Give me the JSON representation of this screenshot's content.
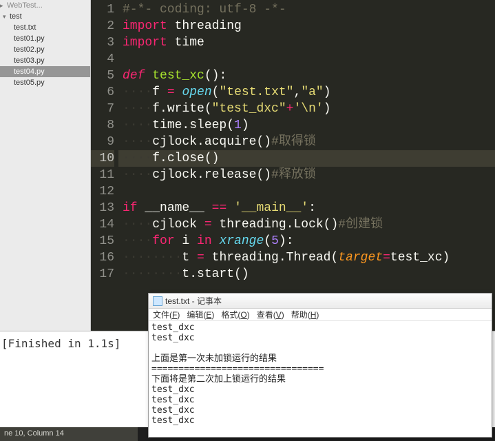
{
  "sidebar": {
    "root_hint": "WebTest...",
    "folder": "test",
    "items": [
      {
        "label": "test.txt"
      },
      {
        "label": "test01.py"
      },
      {
        "label": "test02.py"
      },
      {
        "label": "test03.py"
      },
      {
        "label": "test04.py",
        "active": true
      },
      {
        "label": "test05.py"
      }
    ]
  },
  "editor": {
    "current_line": 10,
    "lines": [
      {
        "n": 1,
        "html": "<span class='tok-comment'>#-*- coding: utf-8 -*-</span>"
      },
      {
        "n": 2,
        "html": "<span class='tok-kw'>import</span> threading"
      },
      {
        "n": 3,
        "html": "<span class='tok-kw'>import</span> time"
      },
      {
        "n": 4,
        "html": ""
      },
      {
        "n": 5,
        "html": "<span class='tok-kw-i'>def</span> <span class='tok-fn'>test_xc</span>():"
      },
      {
        "n": 6,
        "html": "<span class='tok-indent'>····</span>f <span class='tok-op'>=</span> <span class='tok-builtin'>open</span>(<span class='tok-str'>\"test.txt\"</span>,<span class='tok-str'>\"a\"</span>)"
      },
      {
        "n": 7,
        "html": "<span class='tok-indent'>····</span>f.write(<span class='tok-str'>\"test_dxc\"</span><span class='tok-op'>+</span><span class='tok-str'>'\\n'</span>)"
      },
      {
        "n": 8,
        "html": "<span class='tok-indent'>····</span>time.sleep(<span class='tok-num'>1</span>)"
      },
      {
        "n": 9,
        "html": "<span class='tok-indent'>····</span>cjlock.acquire()<span class='tok-comment'>#取得锁</span>"
      },
      {
        "n": 10,
        "html": "<span class='tok-indent'>····</span>f.close()"
      },
      {
        "n": 11,
        "html": "<span class='tok-indent'>····</span>cjlock.release()<span class='tok-comment'>#释放锁</span>"
      },
      {
        "n": 12,
        "html": ""
      },
      {
        "n": 13,
        "html": "<span class='tok-kw'>if</span> __name__ <span class='tok-op'>==</span> <span class='tok-str'>'__main__'</span>:"
      },
      {
        "n": 14,
        "html": "<span class='tok-indent'>····</span>cjlock <span class='tok-op'>=</span> threading.Lock()<span class='tok-comment'>#创建锁</span>"
      },
      {
        "n": 15,
        "html": "<span class='tok-indent'>····</span><span class='tok-kw'>for</span> i <span class='tok-kw'>in</span> <span class='tok-builtin'>xrange</span>(<span class='tok-num'>5</span>):"
      },
      {
        "n": 16,
        "html": "<span class='tok-indent'>········</span>t <span class='tok-op'>=</span> threading.Thread(<span class='tok-param'>target</span><span class='tok-op'>=</span>test_xc)"
      },
      {
        "n": 17,
        "html": "<span class='tok-indent'>········</span>t.start()"
      }
    ]
  },
  "console": {
    "text": "[Finished in 1.1s]"
  },
  "status": {
    "text": "ne 10, Column 14"
  },
  "notepad": {
    "title": "test.txt - 记事本",
    "menu": [
      "文件(F)",
      "编辑(E)",
      "格式(O)",
      "查看(V)",
      "帮助(H)"
    ],
    "body": "test_dxc\ntest_dxc\n\n上面是第一次未加锁运行的结果\n================================\n下面将是第二次加上锁运行的结果\ntest_dxc\ntest_dxc\ntest_dxc\ntest_dxc"
  }
}
